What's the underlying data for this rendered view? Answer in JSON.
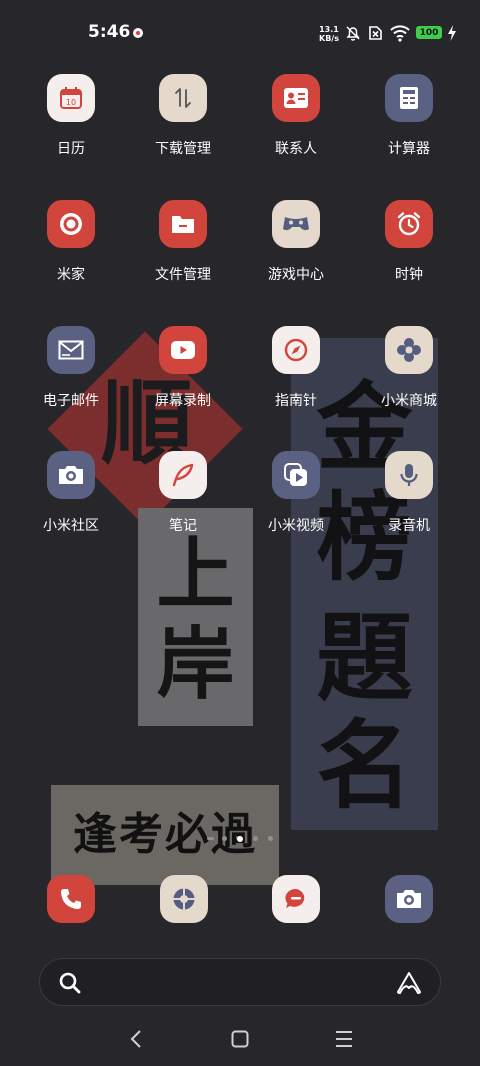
{
  "status_bar": {
    "time": "5:46",
    "net_speed_value": "13.1",
    "net_speed_unit": "KB/s",
    "battery": "100"
  },
  "wallpaper": {
    "diamond_char": "順",
    "vertical_left": [
      "上",
      "岸"
    ],
    "vertical_right": [
      "金",
      "榜",
      "題",
      "名"
    ],
    "banner": "逢考必過"
  },
  "apps": [
    {
      "label": "日历",
      "icon": "calendar-icon",
      "color": "#f4efec",
      "badge": "10"
    },
    {
      "label": "下载管理",
      "icon": "download-manager-icon",
      "color": "#e5d9cc"
    },
    {
      "label": "联系人",
      "icon": "contacts-icon",
      "color": "#d2453c"
    },
    {
      "label": "计算器",
      "icon": "calculator-icon",
      "color": "#5b6183"
    },
    {
      "label": "米家",
      "icon": "mijia-icon",
      "color": "#d2453c"
    },
    {
      "label": "文件管理",
      "icon": "folder-icon",
      "color": "#d2453c"
    },
    {
      "label": "游戏中心",
      "icon": "gamepad-icon",
      "color": "#e5d9cc"
    },
    {
      "label": "时钟",
      "icon": "alarm-clock-icon",
      "color": "#d2453c"
    },
    {
      "label": "电子邮件",
      "icon": "mail-icon",
      "color": "#5b6183"
    },
    {
      "label": "屏幕录制",
      "icon": "screen-record-icon",
      "color": "#d2453c"
    },
    {
      "label": "指南针",
      "icon": "compass-icon",
      "color": "#f4efec"
    },
    {
      "label": "小米商城",
      "icon": "mi-store-icon",
      "color": "#e5d9cc"
    },
    {
      "label": "小米社区",
      "icon": "camera-community-icon",
      "color": "#5b6183"
    },
    {
      "label": "笔记",
      "icon": "notes-feather-icon",
      "color": "#f4efec"
    },
    {
      "label": "小米视频",
      "icon": "video-play-icon",
      "color": "#5b6183"
    },
    {
      "label": "录音机",
      "icon": "microphone-icon",
      "color": "#e5d9cc"
    }
  ],
  "page_indicator": {
    "pages": 4,
    "current": 2
  },
  "dock": [
    {
      "icon": "phone-icon",
      "color": "#d2453c"
    },
    {
      "icon": "browser-icon",
      "color": "#e5d9cc"
    },
    {
      "icon": "messages-icon",
      "color": "#f4efec"
    },
    {
      "icon": "camera-icon",
      "color": "#5b6183"
    }
  ],
  "search_bar": {
    "icon": "search-icon",
    "assistant_icon": "ai-assistant-icon"
  },
  "nav_bar": [
    "back-icon",
    "home-icon",
    "menu-icon"
  ]
}
